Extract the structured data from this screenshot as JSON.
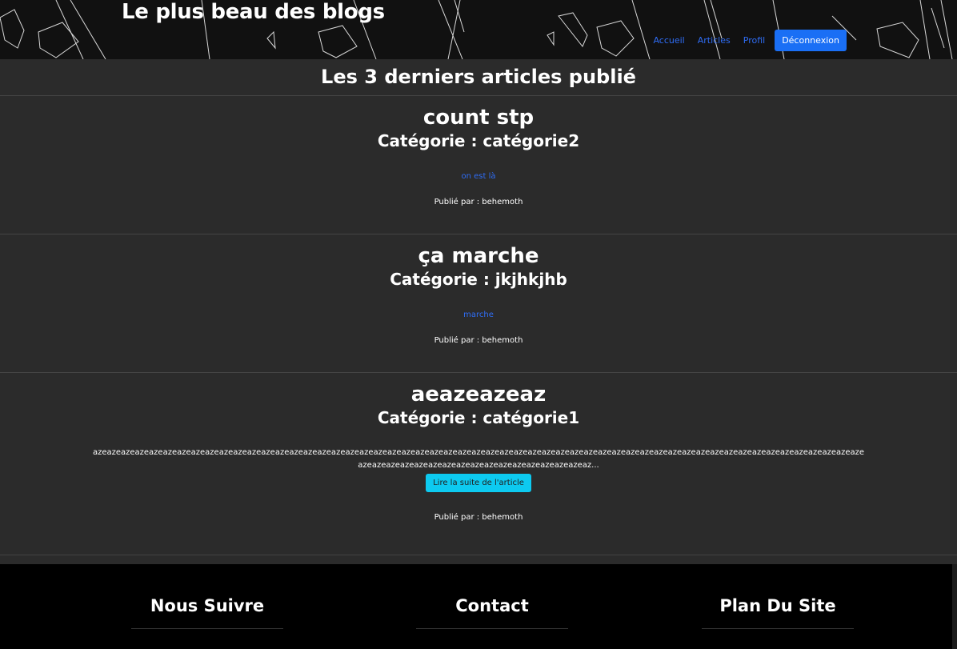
{
  "header": {
    "site_title": "Le plus beau des blogs",
    "nav": {
      "home": "Accueil",
      "articles": "Articles",
      "profile": "Profil",
      "logout": "Déconnexion"
    }
  },
  "main": {
    "section_title": "Les 3 derniers articles publié",
    "articles": [
      {
        "title": "count stp",
        "category": "Catégorie : catégorie2",
        "link_text": "on est là",
        "author": "Publié par : behemoth"
      },
      {
        "title": "ça marche",
        "category": "Catégorie : jkjhkjhb",
        "link_text": "marche",
        "author": "Publié par : behemoth"
      },
      {
        "title": "aeazeazeaz",
        "category": "Catégorie : catégorie1",
        "excerpt": "azeazeazeazeazeazeazeazeazeazeazeazeazeazeazeazeazeazeazeazeazeazeazeazeazeazeazeazeazeazeazeazeazeazeazeazeazeazeazeazeazeazeazeazeazeazeazeazeazeazeazeazeazeazeazeazeazeazeazeazeazeazeazeazeazeazeazeazeazeazeazeaz...",
        "read_more": "Lire la suite de l'article",
        "author": "Publié par : behemoth"
      }
    ]
  },
  "footer": {
    "follow": "Nous Suivre",
    "contact": "Contact",
    "sitemap": "Plan Du Site"
  },
  "colors": {
    "link": "#2f6df6",
    "primary_button": "#1a6ff5",
    "info_button": "#0dcaf0",
    "background": "#2b2b2b",
    "footer": "#000000"
  }
}
